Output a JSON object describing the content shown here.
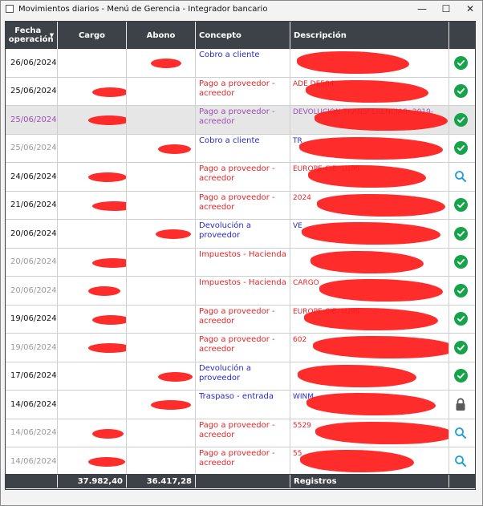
{
  "window": {
    "title": "Movimientos diarios - Menú de Gerencia - Integrador bancario"
  },
  "columns": {
    "fecha": "Fecha operación",
    "cargo": "Cargo",
    "abono": "Abono",
    "concepto": "Concepto",
    "descripcion": "Descripción"
  },
  "rows": [
    {
      "date": "26/06/2024",
      "concepto": "Cobro a cliente",
      "desc": "",
      "icon": "check-circle-icon"
    },
    {
      "date": "25/06/2024",
      "concepto": "Pago a proveedor - acreedor",
      "desc": "ADE DE584",
      "icon": "check-circle-icon"
    },
    {
      "date": "25/06/2024",
      "concepto": "Pago a proveedor - acreedor",
      "desc": "DEVOLUCION TRANSFERENCIAS- 2019-",
      "icon": "check-circle-icon"
    },
    {
      "date": "25/06/2024",
      "concepto": "Cobro a cliente",
      "desc": "TR",
      "icon": "check-circle-icon"
    },
    {
      "date": "24/06/2024",
      "concepto": "Pago a proveedor - acreedor",
      "desc": "EUROPE-CIE- LU96",
      "icon": "search-icon"
    },
    {
      "date": "21/06/2024",
      "concepto": "Pago a proveedor - acreedor",
      "desc": "2024",
      "icon": "check-circle-icon"
    },
    {
      "date": "20/06/2024",
      "concepto": "Devolución a proveedor",
      "desc": "VE",
      "icon": "check-circle-icon"
    },
    {
      "date": "20/06/2024",
      "concepto": "Impuestos - Hacienda",
      "desc": "",
      "icon": "check-circle-icon"
    },
    {
      "date": "20/06/2024",
      "concepto": "Impuestos - Hacienda",
      "desc": "CARGO",
      "icon": "check-circle-icon"
    },
    {
      "date": "19/06/2024",
      "concepto": "Pago a proveedor - acreedor",
      "desc": "EUROPE-CIE- LU96",
      "icon": "check-circle-icon"
    },
    {
      "date": "19/06/2024",
      "concepto": "Pago a proveedor - acreedor",
      "desc": "602",
      "icon": "check-circle-icon"
    },
    {
      "date": "17/06/2024",
      "concepto": "Devolución a proveedor",
      "desc": "",
      "icon": "check-circle-icon"
    },
    {
      "date": "14/06/2024",
      "concepto": "Traspaso - entrada",
      "desc": "WINM",
      "icon": "lock-icon"
    },
    {
      "date": "14/06/2024",
      "concepto": "Pago a proveedor - acreedor",
      "desc": "5529",
      "icon": "search-icon"
    },
    {
      "date": "14/06/2024",
      "concepto": "Pago a proveedor - acreedor",
      "desc": "55",
      "icon": "search-icon"
    }
  ],
  "footer": {
    "cargo_total": "37.982,40",
    "abono_total": "36.417,28",
    "registros_label": "Registros"
  },
  "colors": {
    "header_bg": "#3d4248",
    "ok_green": "#16a34a",
    "blue_text": "#2a2acb",
    "red_text": "#e4262a",
    "purple_text": "#9a4fb3",
    "redaction": "#ff1a1a"
  }
}
